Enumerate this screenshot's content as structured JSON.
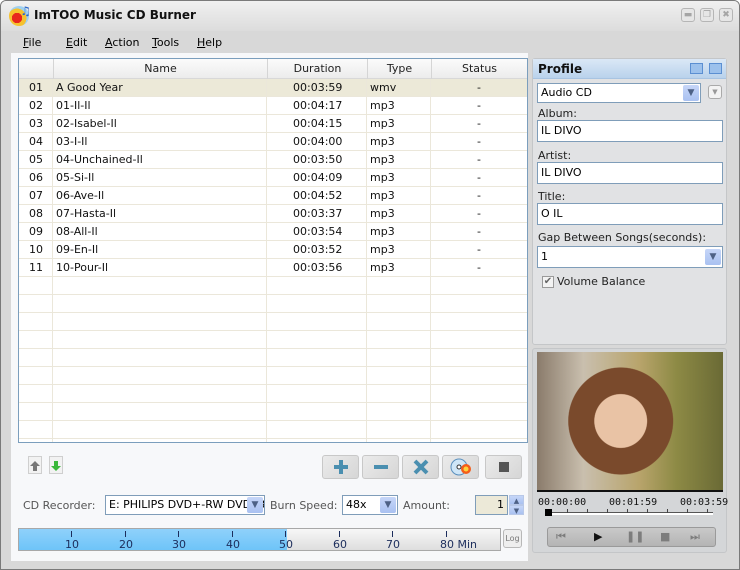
{
  "window": {
    "title": "ImTOO Music CD Burner",
    "controls": [
      "minimize",
      "restore",
      "close"
    ]
  },
  "menu": [
    {
      "label": "File",
      "accel": "F"
    },
    {
      "label": "Edit",
      "accel": "E"
    },
    {
      "label": "Action",
      "accel": "A"
    },
    {
      "label": "Tools",
      "accel": "T"
    },
    {
      "label": "Help",
      "accel": "H"
    }
  ],
  "table": {
    "columns": [
      "",
      "Name",
      "Duration",
      "Type",
      "Status"
    ],
    "rows": [
      {
        "num": "01",
        "name": "A Good Year",
        "duration": "00:03:59",
        "type": "wmv",
        "status": "-",
        "selected": true
      },
      {
        "num": "02",
        "name": "01-Il-Il",
        "duration": "00:04:17",
        "type": "mp3",
        "status": "-"
      },
      {
        "num": "03",
        "name": "02-Isabel-Il",
        "duration": "00:04:15",
        "type": "mp3",
        "status": "-"
      },
      {
        "num": "04",
        "name": "03-I-Il",
        "duration": "00:04:00",
        "type": "mp3",
        "status": "-"
      },
      {
        "num": "05",
        "name": "04-Unchained-Il",
        "duration": "00:03:50",
        "type": "mp3",
        "status": "-"
      },
      {
        "num": "06",
        "name": "05-Si-Il",
        "duration": "00:04:09",
        "type": "mp3",
        "status": "-"
      },
      {
        "num": "07",
        "name": "06-Ave-Il",
        "duration": "00:04:52",
        "type": "mp3",
        "status": "-"
      },
      {
        "num": "08",
        "name": "07-Hasta-Il",
        "duration": "00:03:37",
        "type": "mp3",
        "status": "-"
      },
      {
        "num": "09",
        "name": "08-All-Il",
        "duration": "00:03:54",
        "type": "mp3",
        "status": "-"
      },
      {
        "num": "10",
        "name": "09-En-Il",
        "duration": "00:03:52",
        "type": "mp3",
        "status": "-"
      },
      {
        "num": "11",
        "name": "10-Pour-Il",
        "duration": "00:03:56",
        "type": "mp3",
        "status": "-"
      }
    ]
  },
  "toolbar": {
    "move_up": "move-up-icon",
    "move_down": "move-down-icon",
    "buttons": [
      {
        "name": "add",
        "icon": "plus-icon"
      },
      {
        "name": "remove",
        "icon": "minus-icon"
      },
      {
        "name": "clear",
        "icon": "x-icon"
      },
      {
        "name": "burn",
        "icon": "burn-disc-icon"
      },
      {
        "name": "stop",
        "icon": "stop-icon"
      }
    ]
  },
  "burn": {
    "recorder_label": "CD Recorder:",
    "recorder_value": "E: PHILIPS DVD+-RW DVD88",
    "speed_label": "Burn Speed:",
    "speed_value": "48x",
    "amount_label": "Amount:",
    "amount_value": "1"
  },
  "capacity": {
    "ticks": [
      "10",
      "20",
      "30",
      "40",
      "50",
      "60",
      "70",
      "80 Min"
    ],
    "max_minutes": 80,
    "used_minutes": 44.5,
    "log_label": "Log"
  },
  "profile": {
    "title": "Profile",
    "profile_value": "Audio CD",
    "album_label": "Album:",
    "album_value": "IL DIVO",
    "artist_label": "Artist:",
    "artist_value": "IL DIVO",
    "title_label": "Title:",
    "title_value": "O IL",
    "gap_label": "Gap Between Songs(seconds):",
    "gap_value": "1",
    "volume_balance_label": "Volume Balance",
    "volume_balance_checked": true
  },
  "player": {
    "time_start": "00:00:00",
    "time_mid": "00:01:59",
    "time_end": "00:03:59",
    "position_fraction": 0,
    "buttons": [
      "previous",
      "play",
      "pause",
      "stop",
      "next"
    ]
  }
}
